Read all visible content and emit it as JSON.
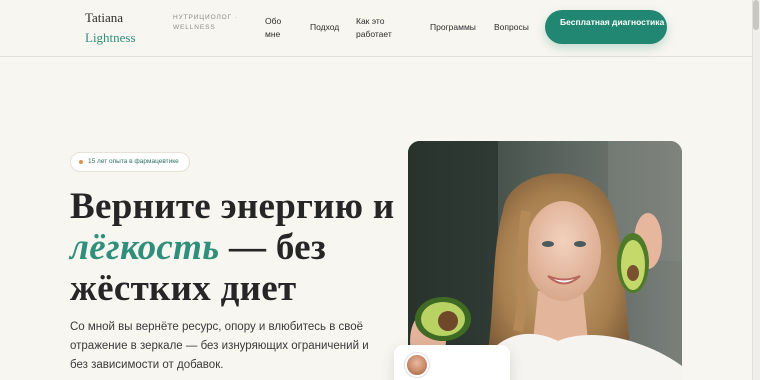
{
  "brand": {
    "name_line1": "Tatiana",
    "name_line2": "Lightness",
    "tagline": "НУТРИЦИОЛОГ · WELLNESS"
  },
  "nav": {
    "items": [
      {
        "label": "Обо мне"
      },
      {
        "label": "Подход"
      },
      {
        "label": "Как это работает"
      },
      {
        "label": "Программы"
      },
      {
        "label": "Вопросы"
      }
    ],
    "cta_label": "Бесплатная диагностика"
  },
  "hero": {
    "badge": "15 лет опыта в фармацевтике",
    "headline_part1": "Верните энергию и",
    "headline_accent": "лёгкость",
    "headline_part2": " — без",
    "headline_part3": "жёстких диет",
    "lead": "Со мной вы вернёте ресурс, опору и влюбитесь в своё отражение в зеркале — без изнуряющих ограничений и без зависимости от добавок."
  },
  "colors": {
    "accent": "#228772",
    "background": "#f8f6f1",
    "badge_dot": "#d9954c"
  }
}
